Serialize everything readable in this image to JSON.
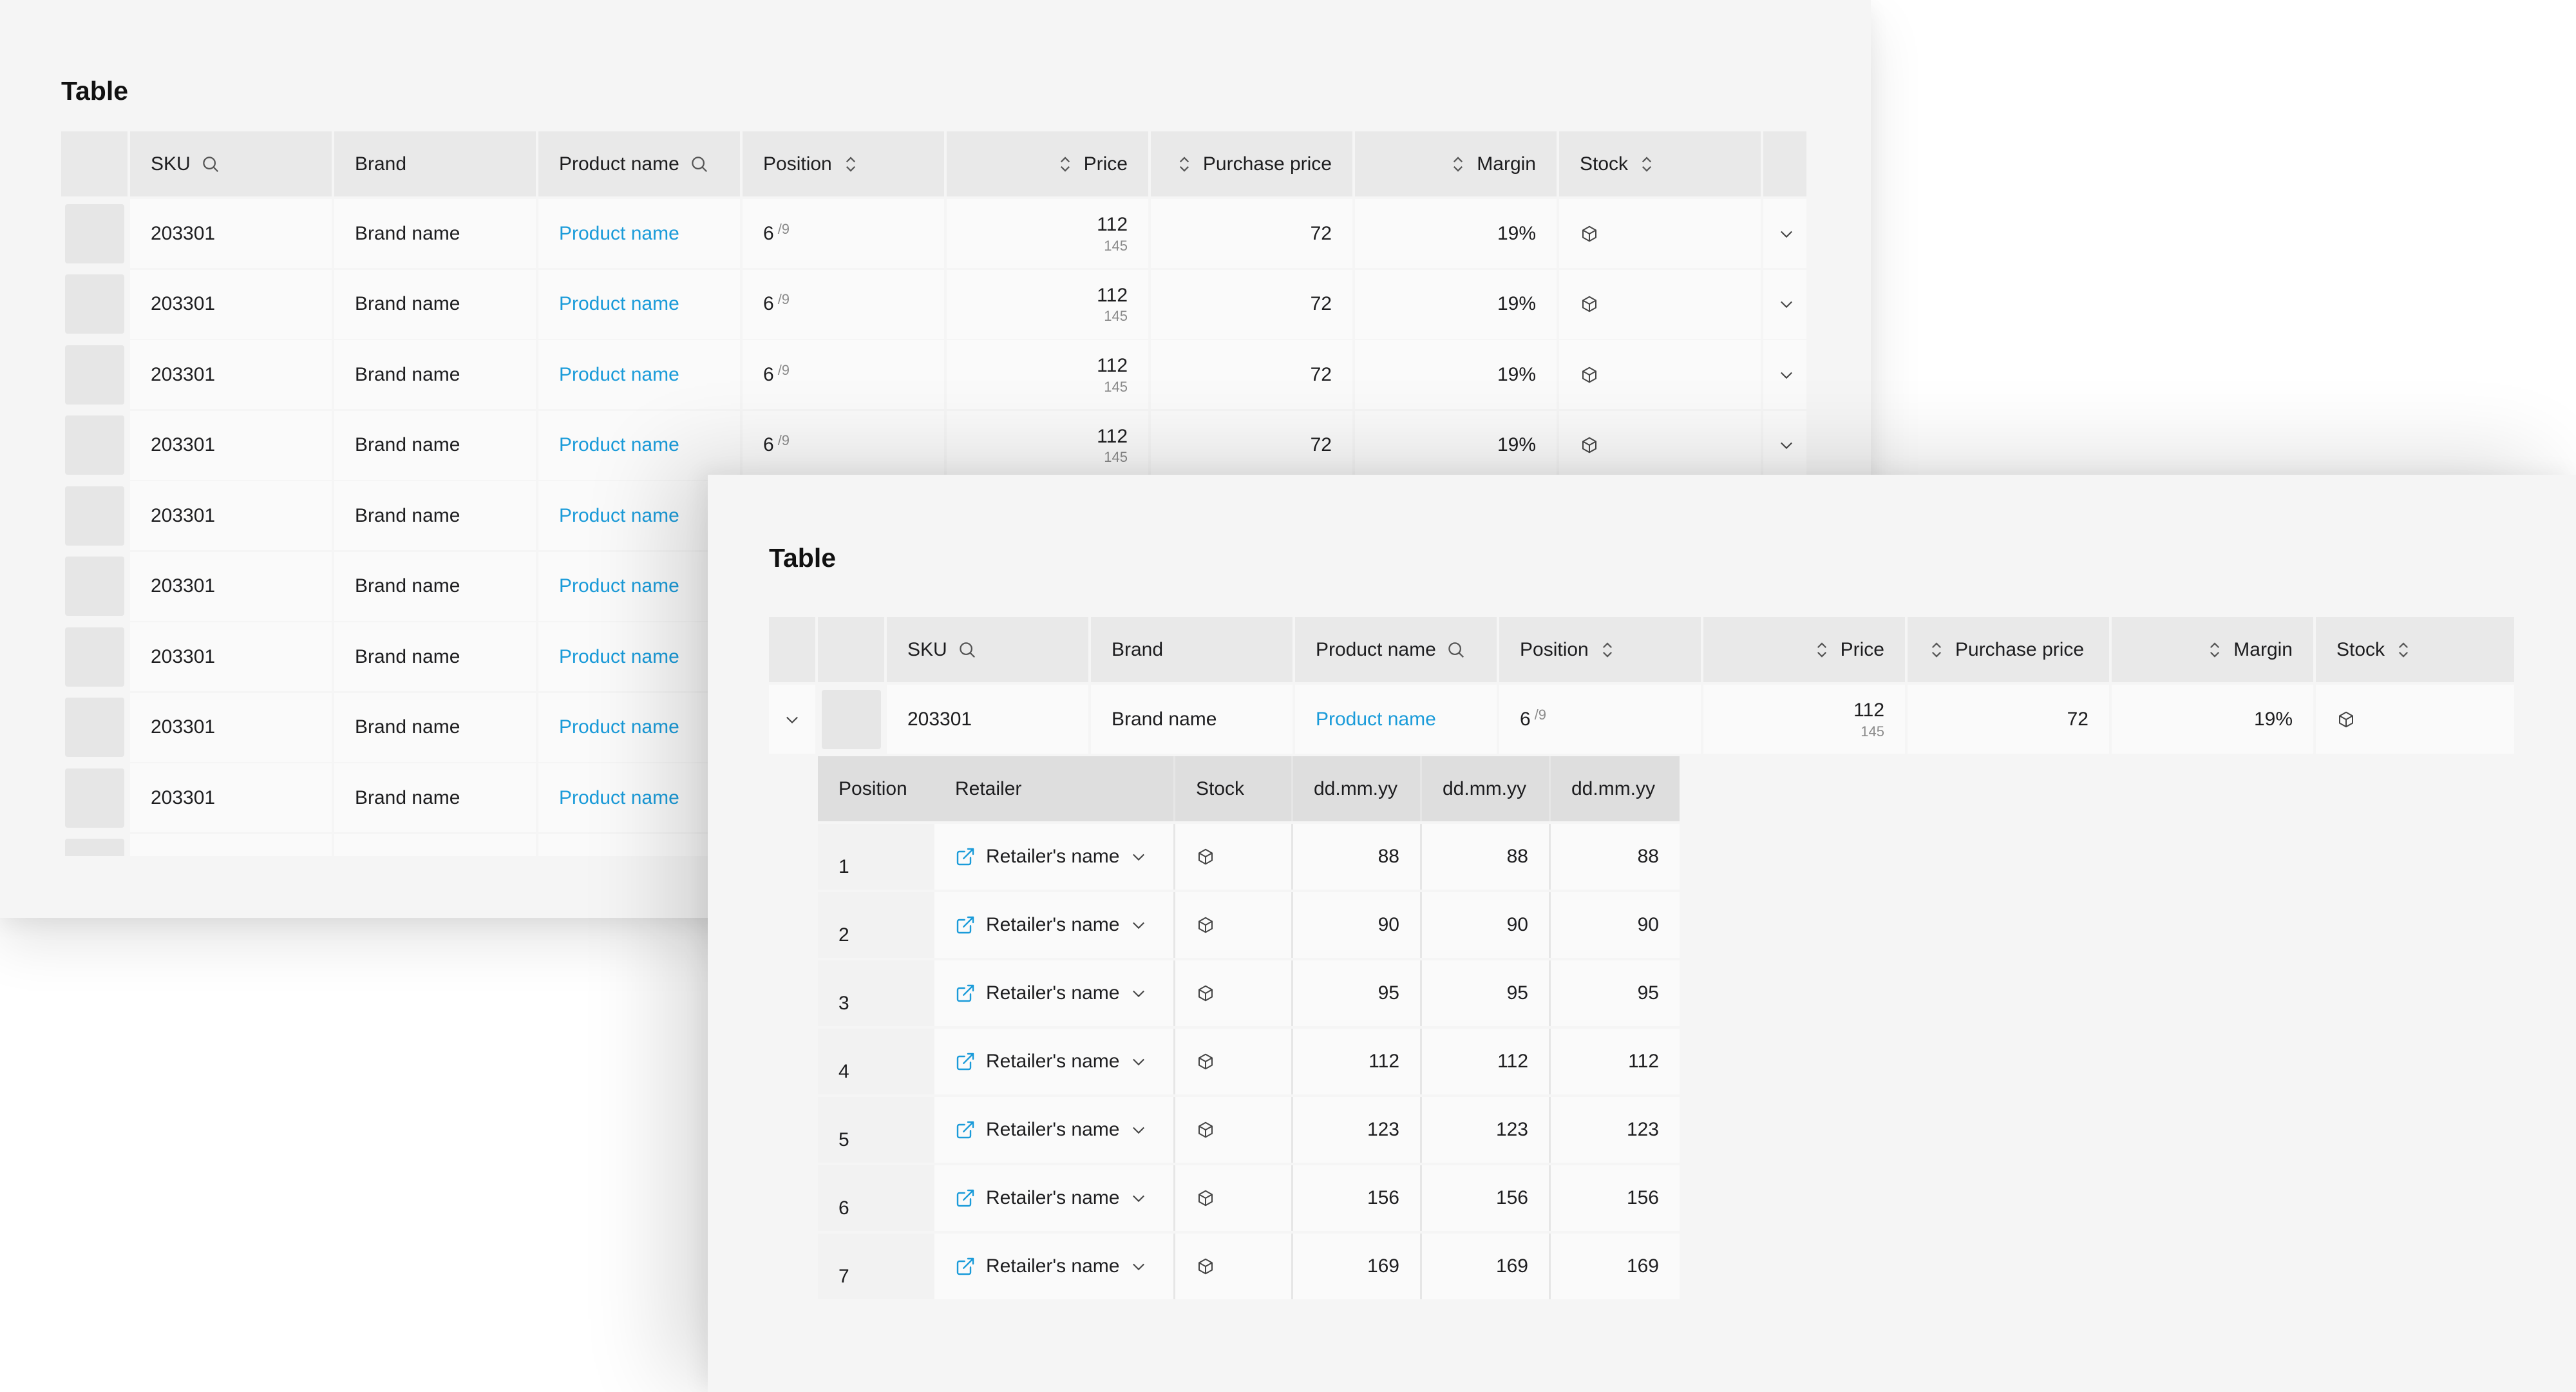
{
  "background_table": {
    "title": "Table",
    "columns": {
      "sku": "SKU",
      "brand": "Brand",
      "product_name": "Product name",
      "position": "Position",
      "price": "Price",
      "purchase_price": "Purchase price",
      "margin": "Margin",
      "stock": "Stock"
    },
    "rows": [
      {
        "sku": "203301",
        "brand": "Brand name",
        "product": "Product name",
        "position": "6",
        "position_total": "/9",
        "price": "112",
        "price_old": "145",
        "purchase": "72",
        "margin": "19%"
      },
      {
        "sku": "203301",
        "brand": "Brand name",
        "product": "Product name",
        "position": "6",
        "position_total": "/9",
        "price": "112",
        "price_old": "145",
        "purchase": "72",
        "margin": "19%"
      },
      {
        "sku": "203301",
        "brand": "Brand name",
        "product": "Product name",
        "position": "6",
        "position_total": "/9",
        "price": "112",
        "price_old": "145",
        "purchase": "72",
        "margin": "19%"
      },
      {
        "sku": "203301",
        "brand": "Brand name",
        "product": "Product name",
        "position": "6",
        "position_total": "/9",
        "price": "112",
        "price_old": "145",
        "purchase": "72",
        "margin": "19%"
      },
      {
        "sku": "203301",
        "brand": "Brand name",
        "product": "Product name"
      },
      {
        "sku": "203301",
        "brand": "Brand name",
        "product": "Product name"
      },
      {
        "sku": "203301",
        "brand": "Brand name",
        "product": "Product name"
      },
      {
        "sku": "203301",
        "brand": "Brand name",
        "product": "Product name"
      },
      {
        "sku": "203301",
        "brand": "Brand name",
        "product": "Product name"
      }
    ]
  },
  "foreground_table": {
    "title": "Table",
    "columns": {
      "sku": "SKU",
      "brand": "Brand",
      "product_name": "Product name",
      "position": "Position",
      "price": "Price",
      "purchase_price": "Purchase price",
      "margin": "Margin",
      "stock": "Stock"
    },
    "row": {
      "sku": "203301",
      "brand": "Brand name",
      "product": "Product name",
      "position": "6",
      "position_total": "/9",
      "price": "112",
      "price_old": "145",
      "purchase": "72",
      "margin": "19%"
    },
    "subtable": {
      "columns": {
        "position": "Position",
        "retailer": "Retailer",
        "stock": "Stock",
        "date1": "dd.mm.yy",
        "date2": "dd.mm.yy",
        "date3": "dd.mm.yy"
      },
      "rows": [
        {
          "position": "1",
          "retailer": "Retailer's name",
          "d1": "88",
          "d2": "88",
          "d3": "88"
        },
        {
          "position": "2",
          "retailer": "Retailer's name",
          "d1": "90",
          "d2": "90",
          "d3": "90"
        },
        {
          "position": "3",
          "retailer": "Retailer's name",
          "d1": "95",
          "d2": "95",
          "d3": "95"
        },
        {
          "position": "4",
          "retailer": "Retailer's name",
          "d1": "112",
          "d2": "112",
          "d3": "112"
        },
        {
          "position": "5",
          "retailer": "Retailer's name",
          "d1": "123",
          "d2": "123",
          "d3": "123"
        },
        {
          "position": "6",
          "retailer": "Retailer's name",
          "d1": "156",
          "d2": "156",
          "d3": "156"
        },
        {
          "position": "7",
          "retailer": "Retailer's name",
          "d1": "169",
          "d2": "169",
          "d3": "169"
        }
      ]
    }
  },
  "icons": {
    "search": "search-icon",
    "sort": "sort-icon",
    "stock": "box-icon",
    "expand": "chevron-down-icon",
    "external": "external-link-icon"
  },
  "colors": {
    "link": "#1a9bd9",
    "header_bg": "#e9e9e9",
    "card_bg": "#f5f5f5"
  }
}
